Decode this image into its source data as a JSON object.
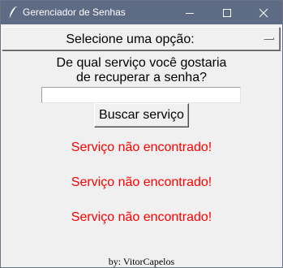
{
  "window": {
    "title": "Gerenciador de Senhas"
  },
  "menu": {
    "selected_label": "Selecione uma opção:"
  },
  "form": {
    "question_line1": "De qual serviço você gostaria",
    "question_line2": "de recuperar a senha?",
    "service_input_value": "",
    "search_button_label": "Buscar serviço"
  },
  "results": [
    "Serviço não encontrado!",
    "Serviço não encontrado!",
    "Serviço não encontrado!"
  ],
  "footer": {
    "credit": "by: VitorCapelos"
  },
  "colors": {
    "titlebar": "#5d6b84",
    "error_text": "#ff0000",
    "background": "#f0f0f0"
  },
  "icons": {
    "app": "feather-icon",
    "minimize": "minimize-icon",
    "maximize": "maximize-icon",
    "close": "close-icon"
  }
}
